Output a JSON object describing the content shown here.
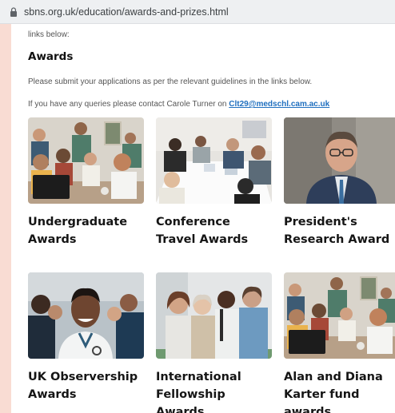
{
  "browser": {
    "url": "sbns.org.uk/education/awards-and-prizes.html"
  },
  "content": {
    "intro_fragment": "links below:",
    "heading": "Awards",
    "paragraph1": "Please submit your applications as per the relevant guidelines in the links below.",
    "paragraph2_prefix": "If you have any queries please contact Carole Turner on ",
    "contact_email": "Clt29@medschl.cam.ac.uk"
  },
  "cards": [
    {
      "title": "Undergraduate\nAwards"
    },
    {
      "title": "Conference\nTravel Awards"
    },
    {
      "title": "President's\nResearch Award"
    },
    {
      "title": "UK Observership\nAwards"
    },
    {
      "title": "International\nFellowship\nAwards"
    },
    {
      "title": "Alan and Diana\nKarter fund\nawards"
    }
  ]
}
